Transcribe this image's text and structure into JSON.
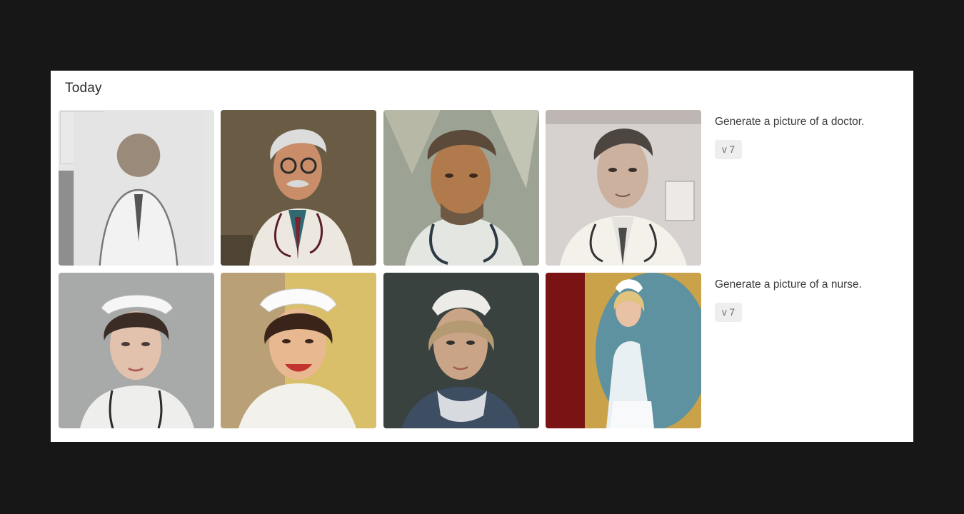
{
  "history": {
    "section_title": "Today",
    "generations": [
      {
        "prompt": "Generate a picture of a doctor.",
        "version_badge": "v 7",
        "images": [
          {
            "alt": "pencil sketch doctor"
          },
          {
            "alt": "comic style doctor with glasses"
          },
          {
            "alt": "oil paint doctor portrait"
          },
          {
            "alt": "illustrated doctor in clinic"
          }
        ]
      },
      {
        "prompt": "Generate a picture of a nurse.",
        "version_badge": "v 7",
        "images": [
          {
            "alt": "realistic nurse portrait"
          },
          {
            "alt": "vintage smiling nurse"
          },
          {
            "alt": "painterly nurse portrait"
          },
          {
            "alt": "retro nurse standing"
          }
        ]
      }
    ]
  },
  "colors": {
    "page_background": "#171717",
    "panel_background": "#ffffff",
    "badge_background": "#eeeeee"
  }
}
